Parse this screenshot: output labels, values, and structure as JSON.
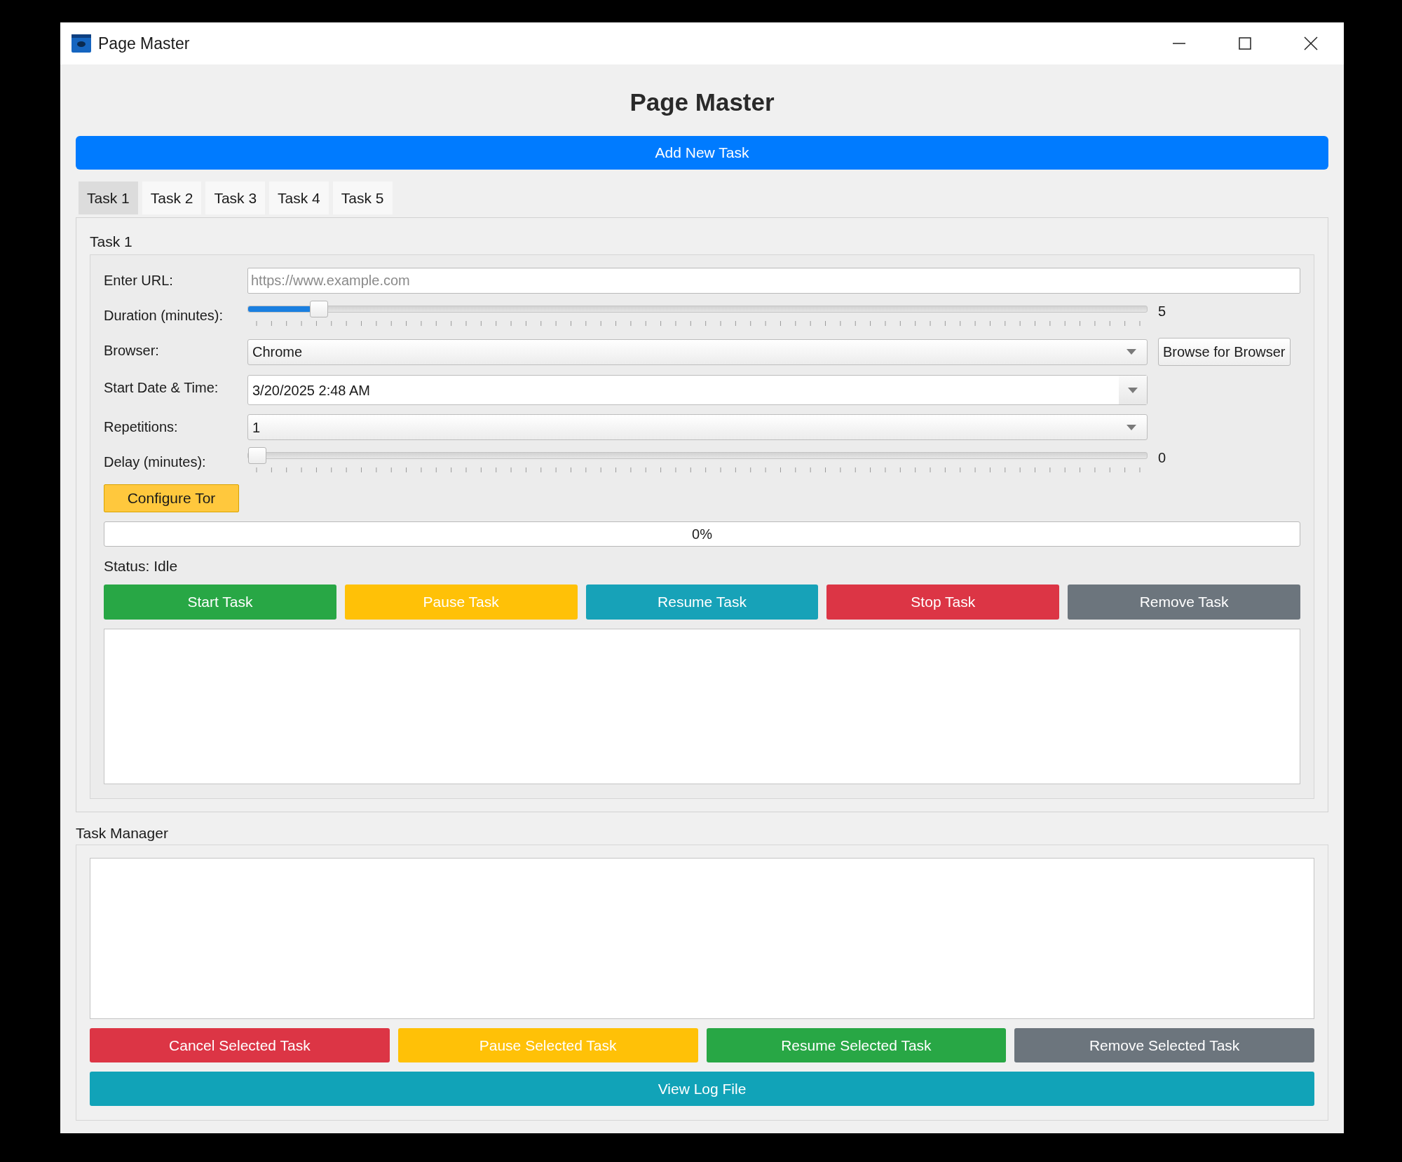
{
  "window": {
    "title": "Page Master"
  },
  "heading": "Page Master",
  "add_button": "Add New Task",
  "tabs": [
    {
      "label": "Task 1",
      "selected": true
    },
    {
      "label": "Task 2",
      "selected": false
    },
    {
      "label": "Task 3",
      "selected": false
    },
    {
      "label": "Task 4",
      "selected": false
    },
    {
      "label": "Task 5",
      "selected": false
    }
  ],
  "task": {
    "title": "Task 1",
    "rows": [
      {
        "kind": "text",
        "label": "Enter URL:",
        "placeholder": "https://www.example.com"
      },
      {
        "kind": "slider",
        "label": "Duration (minutes):",
        "level": 0.07,
        "reading": "5"
      },
      {
        "kind": "combo",
        "label": "Browser:",
        "value": "Chrome",
        "button": "Browse for Browser"
      },
      {
        "kind": "date",
        "label": "Start Date & Time:",
        "value": "3/20/2025 2:48 AM"
      },
      {
        "kind": "combo",
        "label": "Repetitions:",
        "value": "1"
      },
      {
        "kind": "slider",
        "label": "Delay (minutes):",
        "level": 0,
        "reading": "0"
      }
    ],
    "configure_button": "Configure Tor",
    "progress": {
      "level": 0,
      "reading": "0%"
    },
    "status": "Status: Idle",
    "buttons": [
      {
        "label": "Start Task",
        "color": "#28a745"
      },
      {
        "label": "Pause Task",
        "color": "#ffc107"
      },
      {
        "label": "Resume Task",
        "color": "#17a2b8"
      },
      {
        "label": "Stop Task",
        "color": "#dc3545"
      },
      {
        "label": "Remove Task",
        "color": "#6c757d"
      }
    ]
  },
  "task_manager": {
    "title": "Task Manager",
    "buttons": [
      {
        "label": "Cancel Selected Task",
        "color": "#dc3545"
      },
      {
        "label": "Pause Selected Task",
        "color": "#ffc107"
      },
      {
        "label": "Resume Selected Task",
        "color": "#28a745"
      },
      {
        "label": "Remove Selected Task",
        "color": "#6c757d"
      }
    ],
    "log_button": "View Log File"
  }
}
